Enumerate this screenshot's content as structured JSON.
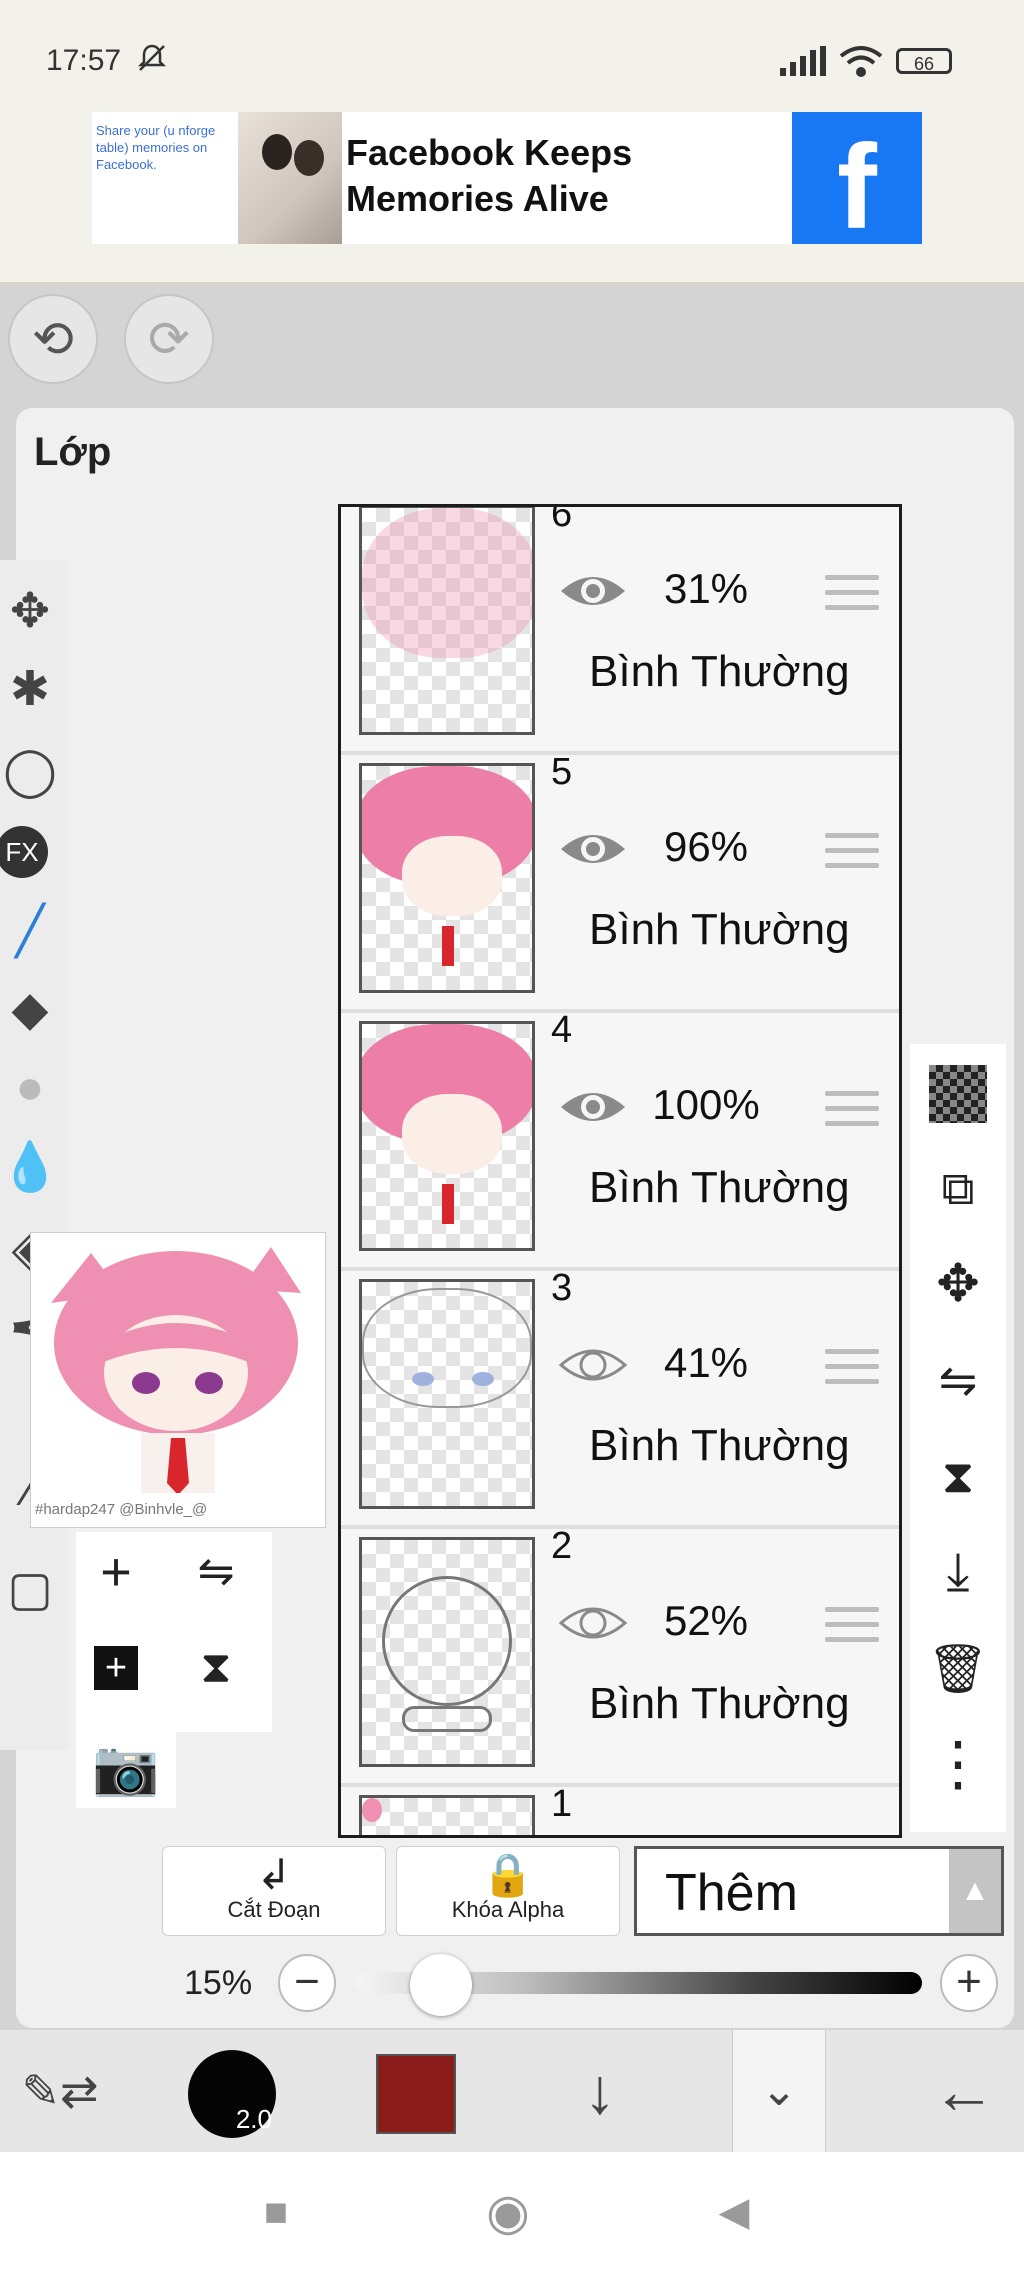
{
  "status": {
    "time": "17:57",
    "battery": "66"
  },
  "ad": {
    "small_text": "Share your (u nforge table) memories on Facebook.",
    "headline_1": "Facebook Keeps",
    "headline_2": "Memories Alive",
    "logo": "f"
  },
  "panel": {
    "title": "Lớp"
  },
  "layers": [
    {
      "number": "6",
      "opacity": "31%",
      "blend": "Bình Thường",
      "visible": true
    },
    {
      "number": "5",
      "opacity": "96%",
      "blend": "Bình Thường",
      "visible": true
    },
    {
      "number": "4",
      "opacity": "100%",
      "blend": "Bình Thường",
      "visible": true
    },
    {
      "number": "3",
      "opacity": "41%",
      "blend": "Bình Thường",
      "visible": false
    },
    {
      "number": "2",
      "opacity": "52%",
      "blend": "Bình Thường",
      "visible": false
    },
    {
      "number": "1"
    }
  ],
  "preview": {
    "credit": "#hardap247 @Binhvle_@"
  },
  "controls": {
    "clip_label": "Cắt Đoạn",
    "alpha_lock_label": "Khóa Alpha",
    "blend_mode": "Thêm",
    "opacity_percent": "15%",
    "opacity_value": 0.15
  },
  "toolbar": {
    "brush_size": "2.0",
    "color": "#8b1c1c"
  },
  "icons": {
    "left_tools": [
      "move-icon",
      "magic-wand-icon",
      "lasso-icon",
      "fx-icon",
      "brush-icon",
      "eraser-icon",
      "smudge-icon",
      "blur-icon",
      "fill-icon",
      "pen-icon",
      "dropper-icon",
      "canvas-icon"
    ],
    "right_tools": [
      "checker-icon",
      "transfer-icon",
      "move-icon",
      "flip-horizontal-icon",
      "flip-vertical-icon",
      "merge-down-icon",
      "trash-icon",
      "more-icon"
    ]
  }
}
